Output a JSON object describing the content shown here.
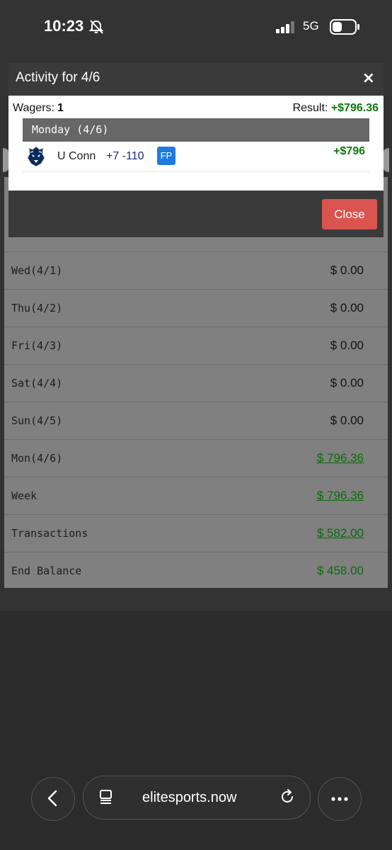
{
  "status_bar": {
    "time": "10:23",
    "network": "5G",
    "icons": [
      "bell-muted-icon",
      "signal-icon",
      "battery-icon"
    ]
  },
  "modal": {
    "title": "Activity for 4/6",
    "close_glyph": "×",
    "wagers_label": "Wagers:",
    "wagers_count": "1",
    "result_label": "Result:",
    "result_amount": "+$796.36",
    "day_header": "Monday (4/6)",
    "wager": {
      "team_logo": "uconn-husky-logo",
      "team": "U Conn",
      "line": "+7 -110",
      "badge": "FP",
      "amount": "+$796"
    },
    "close_button": "Close"
  },
  "weekly_table": {
    "rows": [
      {
        "label": "Wed(4/1)",
        "value": "$ 0.00",
        "style": "plain"
      },
      {
        "label": "Thu(4/2)",
        "value": "$ 0.00",
        "style": "plain"
      },
      {
        "label": "Fri(4/3)",
        "value": "$ 0.00",
        "style": "plain"
      },
      {
        "label": "Sat(4/4)",
        "value": "$ 0.00",
        "style": "plain"
      },
      {
        "label": "Sun(4/5)",
        "value": "$ 0.00",
        "style": "plain"
      },
      {
        "label": "Mon(4/6)",
        "value": "$ 796.36",
        "style": "green-link"
      },
      {
        "label": "Week",
        "value": "$ 796.36",
        "style": "green-link"
      },
      {
        "label": "Transactions",
        "value": "$ 582.00",
        "style": "green-link"
      },
      {
        "label": "End Balance",
        "value": "$ 458.00",
        "style": "green"
      }
    ]
  },
  "browser": {
    "url": "elitesports.now",
    "icons": [
      "back-chevron-icon",
      "tabs-icon",
      "reload-icon",
      "more-dots-icon"
    ]
  },
  "colors": {
    "positive": "#0b7a0b",
    "close_button": "#d9534f",
    "badge_blue": "#1e7be0",
    "overlay": "#808080"
  }
}
